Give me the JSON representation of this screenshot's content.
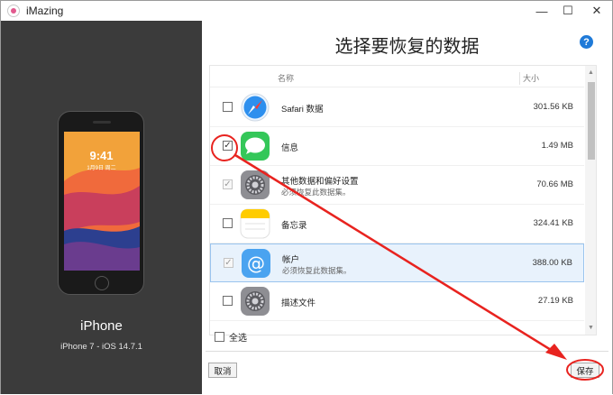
{
  "window": {
    "title": "iMazing",
    "controls": {
      "minimize": "—",
      "maximize": "☐",
      "close": "✕"
    }
  },
  "device": {
    "name": "iPhone",
    "version": "iPhone 7 - iOS 14.7.1",
    "lock_time": "9:41",
    "lock_date": "1月9日 周二"
  },
  "main": {
    "heading": "选择要恢复的数据",
    "help": "?",
    "columns": {
      "name": "名称",
      "size": "大小"
    },
    "items": [
      {
        "title": "Safari 数据",
        "subtitle": "",
        "size": "301.56 KB",
        "checked": false,
        "disabled": false,
        "icon": "safari-icon"
      },
      {
        "title": "信息",
        "subtitle": "",
        "size": "1.49 MB",
        "checked": true,
        "disabled": false,
        "icon": "messages-icon"
      },
      {
        "title": "其他数据和偏好设置",
        "subtitle": "必须恢复此数据集。",
        "size": "70.66 MB",
        "checked": true,
        "disabled": true,
        "icon": "settings-icon"
      },
      {
        "title": "备忘录",
        "subtitle": "",
        "size": "324.41 KB",
        "checked": false,
        "disabled": false,
        "icon": "notes-icon"
      },
      {
        "title": "帐户",
        "subtitle": "必须恢复此数据集。",
        "size": "388.00 KB",
        "checked": true,
        "disabled": true,
        "icon": "accounts-icon"
      },
      {
        "title": "描述文件",
        "subtitle": "",
        "size": "27.19 KB",
        "checked": false,
        "disabled": false,
        "icon": "profiles-icon"
      }
    ],
    "select_all": "全选"
  },
  "footer": {
    "cancel": "取消",
    "save": "保存"
  },
  "colors": {
    "annotation": "#e8231f",
    "accent": "#1f7ad8",
    "sidebar": "#3b3b3b"
  }
}
